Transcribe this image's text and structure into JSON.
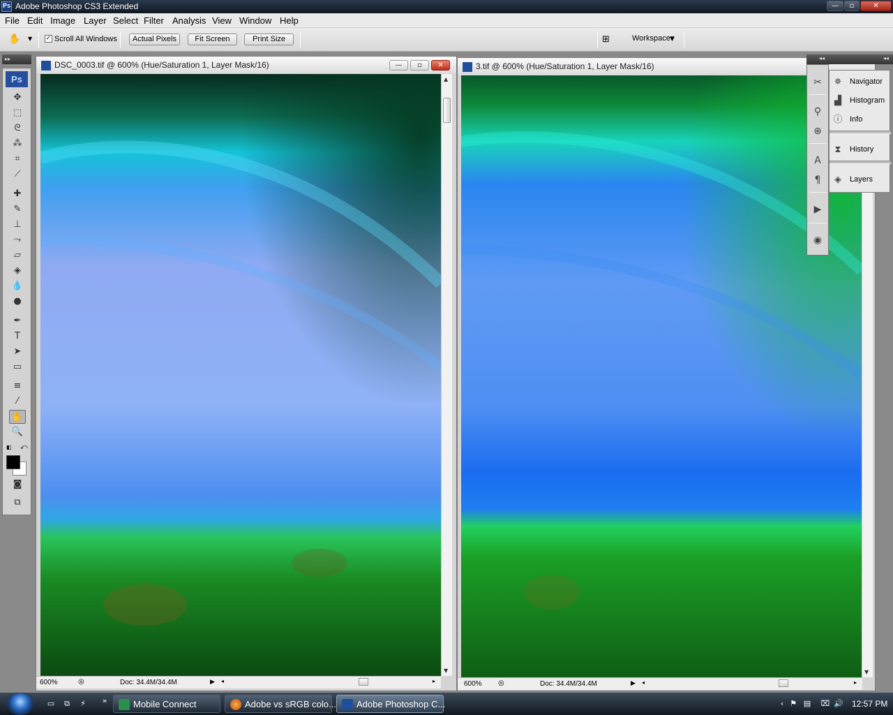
{
  "app": {
    "title": "Adobe Photoshop CS3 Extended"
  },
  "menu": [
    "File",
    "Edit",
    "Image",
    "Layer",
    "Select",
    "Filter",
    "Analysis",
    "View",
    "Window",
    "Help"
  ],
  "options": {
    "scroll_all_label": "Scroll All Windows",
    "scroll_all_checked": true,
    "actual_pixels": "Actual Pixels",
    "fit_screen": "Fit Screen",
    "print_size": "Print Size",
    "workspace": "Workspace"
  },
  "toolbox": {
    "badge": "Ps"
  },
  "documents": [
    {
      "title": "DSC_0003.tif @ 600% (Hue/Saturation 1, Layer Mask/16)",
      "zoom": "600%",
      "doc_size": "Doc: 34.4M/34.4M"
    },
    {
      "title": "3.tif @ 600% (Hue/Saturation 1, Layer Mask/16)",
      "zoom": "600%",
      "doc_size": "Doc: 34.4M/34.4M"
    }
  ],
  "panels": {
    "group1": [
      "Navigator",
      "Histogram",
      "Info"
    ],
    "group2": [
      "History"
    ],
    "group3": [
      "Layers"
    ]
  },
  "taskbar": {
    "buttons": [
      "Mobile Connect",
      "Adobe vs sRGB colo...",
      "Adobe Photoshop C..."
    ],
    "clock": "12:57 PM"
  },
  "colors": {
    "foreground": "#000000",
    "background": "#ffffff",
    "canvas_sky": "#6aa0f0",
    "canvas_grass": "#1f8a22"
  }
}
